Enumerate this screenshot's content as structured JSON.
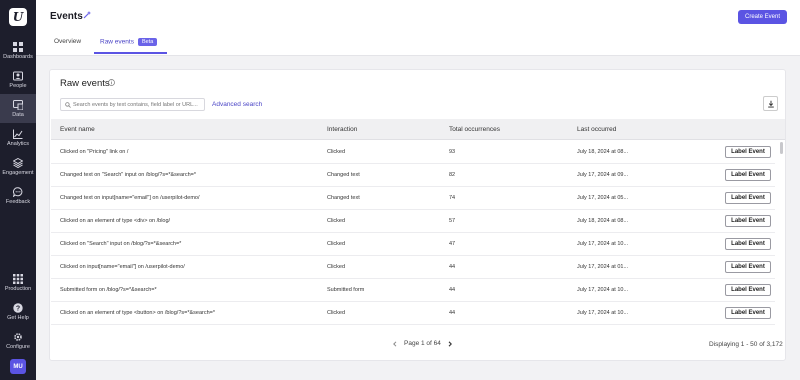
{
  "sidebar": {
    "logo": "U",
    "items": [
      {
        "label": "Dashboards",
        "icon": "dashboard-grid-icon"
      },
      {
        "label": "People",
        "icon": "people-icon"
      },
      {
        "label": "Data",
        "icon": "data-icon",
        "active": true
      },
      {
        "label": "Analytics",
        "icon": "analytics-chart-icon"
      },
      {
        "label": "Engagement",
        "icon": "engagement-layers-icon"
      },
      {
        "label": "Feedback",
        "icon": "feedback-chat-icon"
      }
    ],
    "bottom_items": [
      {
        "label": "Production",
        "icon": "apps-grid-icon"
      },
      {
        "label": "Get Help",
        "icon": "help-icon"
      },
      {
        "label": "Configure",
        "icon": "gear-icon"
      }
    ],
    "avatar": "MU"
  },
  "header": {
    "title": "Events",
    "create_button": "Create Event",
    "tabs": [
      {
        "label": "Overview",
        "active": false
      },
      {
        "label": "Raw events",
        "active": true,
        "badge": "Beta"
      }
    ]
  },
  "card": {
    "title": "Raw events",
    "search_placeholder": "Search events by text contains, field label or URL...",
    "advanced_search": "Advanced search",
    "columns": [
      "Event name",
      "Interaction",
      "Total occurrences",
      "Last occurred"
    ],
    "label_button": "Label Event",
    "rows": [
      {
        "name": "Clicked on \"Pricing\" link on /",
        "interaction": "Clicked",
        "total": "93",
        "last": "July 18, 2024 at 08..."
      },
      {
        "name": "Changed text on \"Search\" input on /blog/?s=*&search=*",
        "interaction": "Changed text",
        "total": "82",
        "last": "July 17, 2024 at 09..."
      },
      {
        "name": "Changed text on input[name=\"email\"] on /userpilot-demo/",
        "interaction": "Changed text",
        "total": "74",
        "last": "July 17, 2024 at 05..."
      },
      {
        "name": "Clicked on an element of type <div> on /blog/",
        "interaction": "Clicked",
        "total": "57",
        "last": "July 18, 2024 at 08..."
      },
      {
        "name": "Clicked on \"Search\" input on /blog/?s=*&search=*",
        "interaction": "Clicked",
        "total": "47",
        "last": "July 17, 2024 at 10..."
      },
      {
        "name": "Clicked on input[name=\"email\"] on /userpilot-demo/",
        "interaction": "Clicked",
        "total": "44",
        "last": "July 17, 2024 at 01..."
      },
      {
        "name": "Submitted form on /blog/?s=*&search=*",
        "interaction": "Submitted form",
        "total": "44",
        "last": "July 17, 2024 at 10..."
      },
      {
        "name": "Clicked on an element of type <button> on /blog/?s=*&search=*",
        "interaction": "Clicked",
        "total": "44",
        "last": "July 17, 2024 at 10..."
      }
    ],
    "pagination": "Page 1 of 64",
    "displaying": "Displaying 1 - 50 of 3,172"
  },
  "colors": {
    "accent": "#5b54e3",
    "sidebar_bg": "#1d1e2c"
  }
}
